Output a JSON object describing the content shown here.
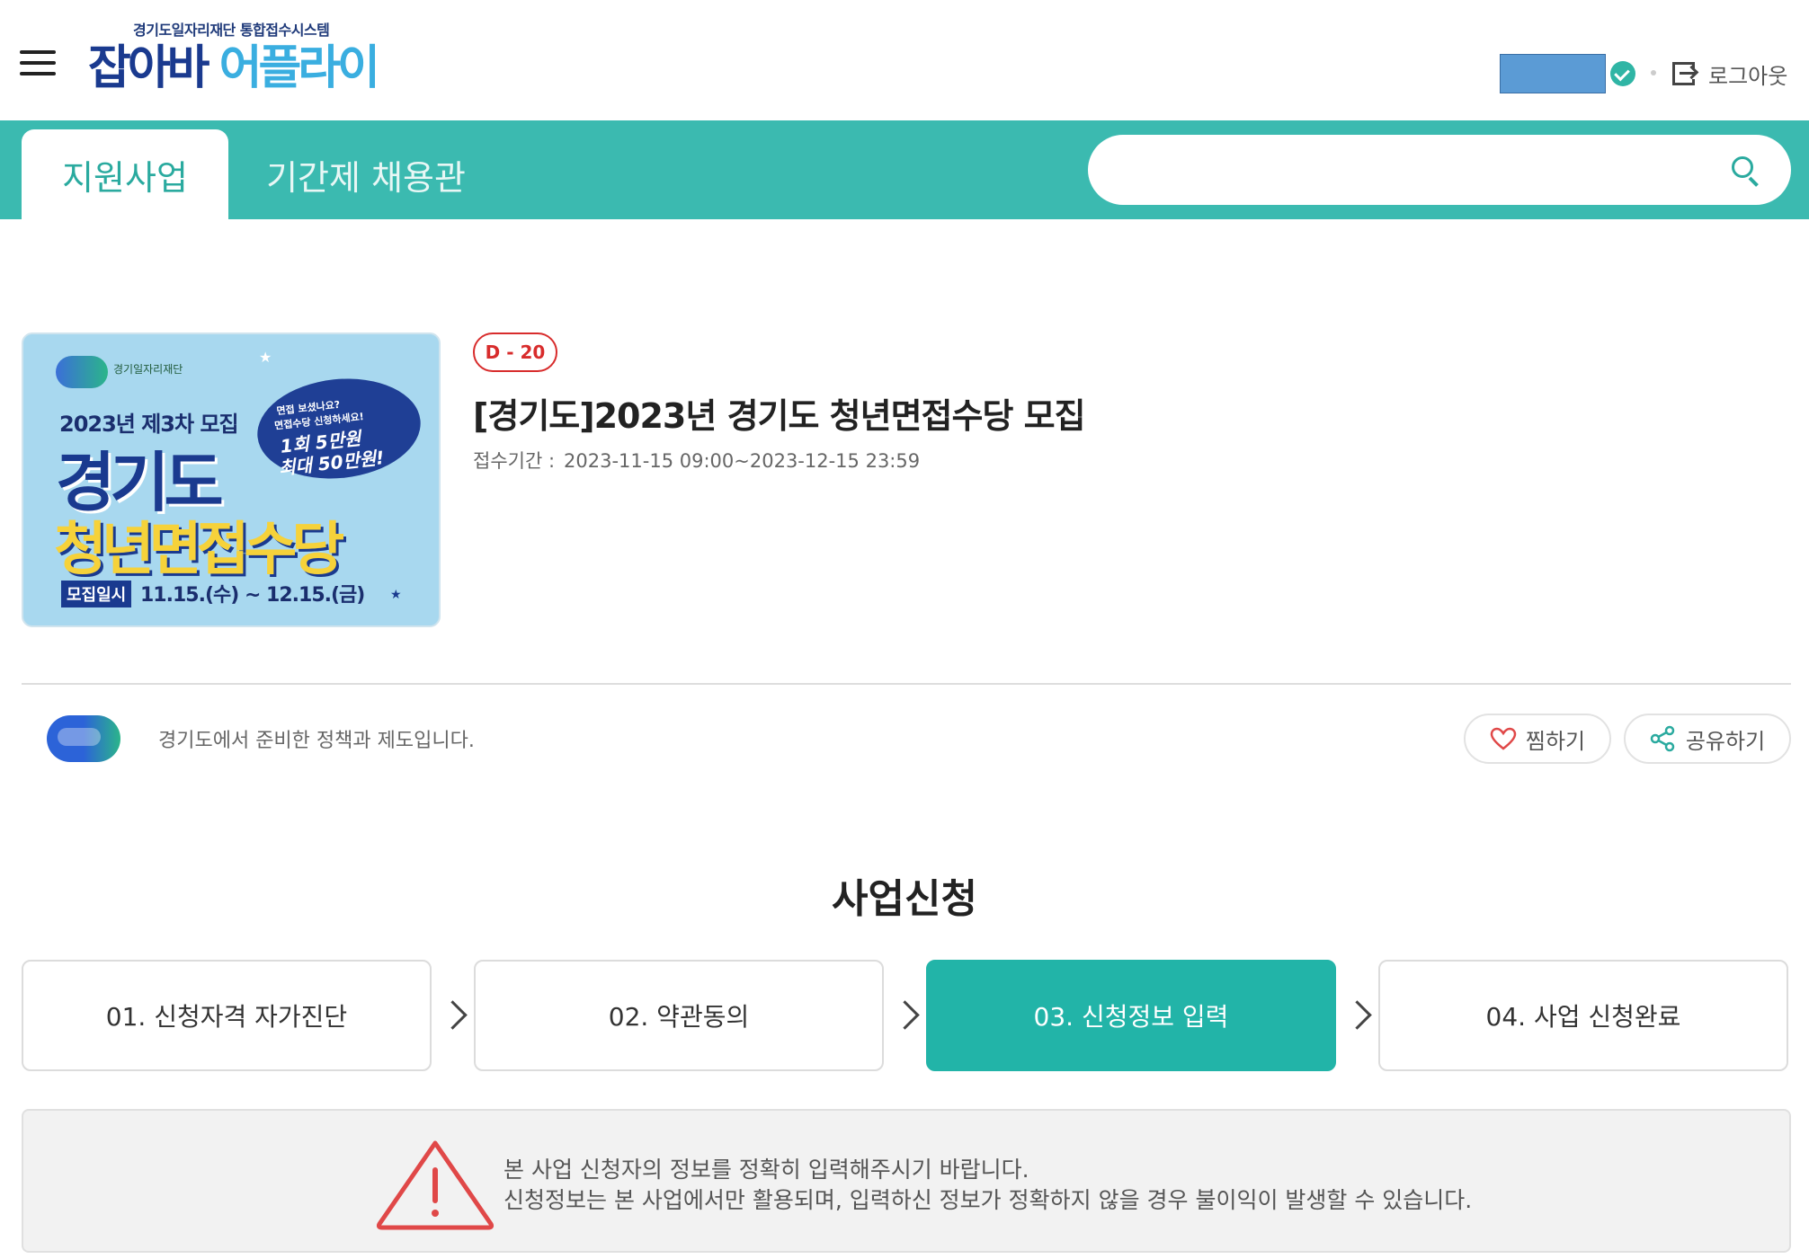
{
  "header": {
    "logo_subtitle": "경기도일자리재단 통합접수시스템",
    "logo_part1": "잡아바",
    "logo_part2": "어플라이",
    "logout_label": "로그아웃"
  },
  "nav": {
    "tabs": [
      {
        "label": "지원사업",
        "active": true
      },
      {
        "label": "기간제 채용관",
        "active": false
      }
    ],
    "search": {
      "placeholder": "",
      "value": ""
    }
  },
  "program": {
    "poster": {
      "round": "2023년 제3차 모집",
      "title_line1": "경기도",
      "title_line2": "청년면접수당",
      "bubble_line1": "면접 보셨나요?",
      "bubble_line2": "면접수당 신청하세요!",
      "bubble_line3": "1회 5만원",
      "bubble_line4": "최대 50만원!",
      "date_label": "모집일시",
      "date_range": "11.15.(수) ~ 12.15.(금)"
    },
    "dday": "D - 20",
    "title": "[경기도]2023년 경기도 청년면접수당 모집",
    "period_label": "접수기간 :",
    "period_value": "2023-11-15 09:00~2023-12-15 23:59"
  },
  "org": {
    "description": "경기도에서 준비한 정책과 제도입니다."
  },
  "actions": {
    "like_label": "찜하기",
    "share_label": "공유하기"
  },
  "application": {
    "section_title": "사업신청",
    "steps": [
      {
        "label": "01. 신청자격 자가진단",
        "active": false
      },
      {
        "label": "02. 약관동의",
        "active": false
      },
      {
        "label": "03. 신청정보 입력",
        "active": true
      },
      {
        "label": "04. 사업 신청완료",
        "active": false
      }
    ]
  },
  "notice": {
    "line1": "본 사업 신청자의 정보를 정확히 입력해주시기 바랍니다.",
    "line2": "신청정보는 본 사업에서만 활용되며, 입력하신 정보가 정확하지 않을 경우 불이익이 발생할 수 있습니다."
  },
  "colors": {
    "accent": "#3bbab0",
    "active_step": "#22b4a8",
    "dday": "#d82c2c",
    "warning": "#e04848"
  },
  "icons": [
    "hamburger-menu-icon",
    "verified-check-icon",
    "logout-icon",
    "search-icon",
    "heart-icon",
    "share-icon",
    "chevron-right-icon",
    "warning-triangle-icon"
  ]
}
